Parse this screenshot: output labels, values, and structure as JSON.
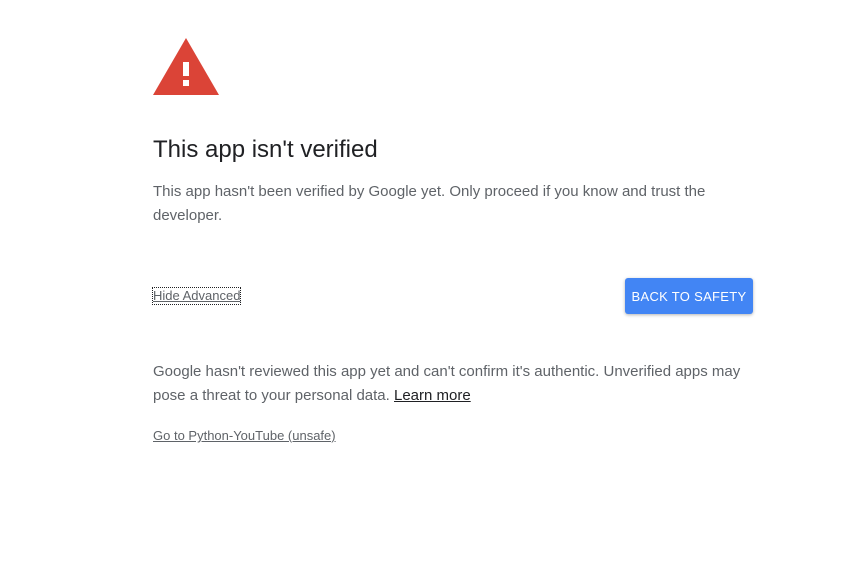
{
  "icon": {
    "name": "warning-icon",
    "color": "#db4437"
  },
  "title": "This app isn't verified",
  "description": "This app hasn't been verified by Google yet. Only proceed if you know and trust the developer.",
  "actions": {
    "hide_advanced_label": "Hide Advanced",
    "back_label": "BACK TO SAFETY"
  },
  "details": {
    "text": "Google hasn't reviewed this app yet and can't confirm it's authentic. Unverified apps may pose a threat to your personal data.",
    "learn_more_label": "Learn more"
  },
  "proceed_label": "Go to Python-YouTube (unsafe)",
  "colors": {
    "accent": "#4285f4",
    "warning": "#db4437",
    "text": "#5f6368",
    "title": "#202124"
  }
}
